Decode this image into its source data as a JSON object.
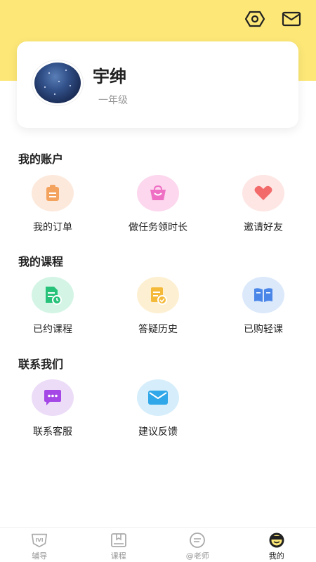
{
  "header": {
    "icons": [
      "settings-hex-icon",
      "mail-icon"
    ],
    "accent_color": "#fce777"
  },
  "profile": {
    "name": "宇绅",
    "grade": "一年级"
  },
  "sections": {
    "account": {
      "title": "我的账户",
      "items": [
        {
          "label": "我的订单",
          "icon": "order-clipboard-icon",
          "bg": "#fde9dc",
          "color": "#f4a35e"
        },
        {
          "label": "做任务领时长",
          "icon": "shopping-bag-icon",
          "bg": "#fcd7ee",
          "color": "#ef6fc4"
        },
        {
          "label": "邀请好友",
          "icon": "heart-icon",
          "bg": "#fde6e4",
          "color": "#f26a6a"
        }
      ]
    },
    "courses": {
      "title": "我的课程",
      "items": [
        {
          "label": "已约课程",
          "icon": "booked-document-icon",
          "bg": "#d4f5e6",
          "color": "#27c27a"
        },
        {
          "label": "答疑历史",
          "icon": "qa-history-icon",
          "bg": "#fdf0d2",
          "color": "#f5b93a"
        },
        {
          "label": "已购轻课",
          "icon": "book-icon",
          "bg": "#dce9fb",
          "color": "#4a86e8"
        }
      ]
    },
    "contact": {
      "title": "联系我们",
      "items": [
        {
          "label": "联系客服",
          "icon": "chat-bubble-icon",
          "bg": "#ecdcf8",
          "color": "#a447e6"
        },
        {
          "label": "建议反馈",
          "icon": "envelope-icon",
          "bg": "#d6eefb",
          "color": "#2fa7e8"
        }
      ]
    }
  },
  "tabbar": {
    "tabs": [
      {
        "label": "辅导",
        "icon": "ivi-icon",
        "active": false
      },
      {
        "label": "课程",
        "icon": "bookmark-book-icon",
        "active": false
      },
      {
        "label": "@老师",
        "icon": "chat-circle-icon",
        "active": false
      },
      {
        "label": "我的",
        "icon": "smiley-icon",
        "active": true
      }
    ]
  }
}
